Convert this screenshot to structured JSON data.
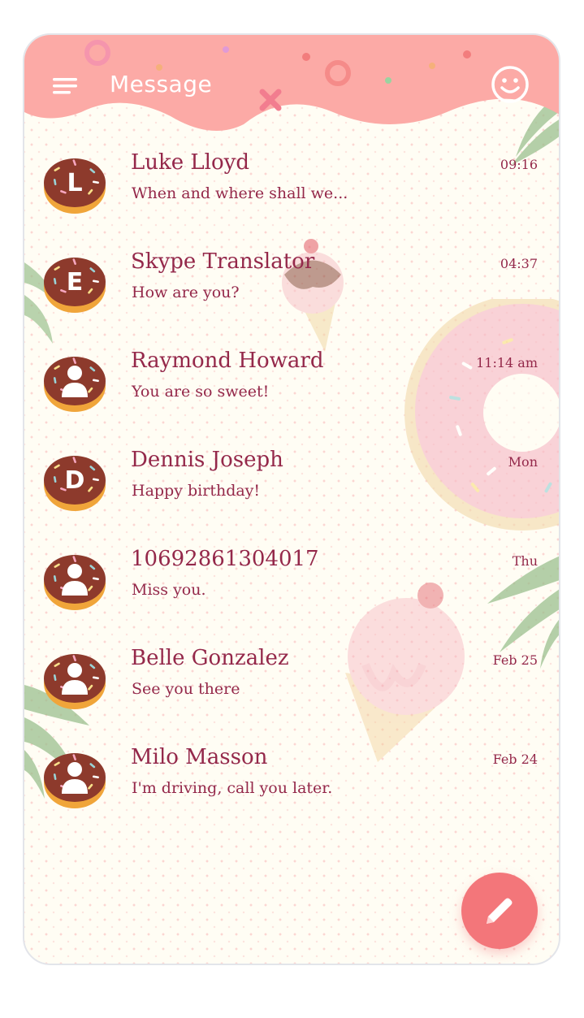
{
  "header": {
    "title": "Message",
    "menu_icon": "menu-icon",
    "smiley_icon": "smiley-icon",
    "color": "#fcaaa6"
  },
  "conversations": [
    {
      "name": "Luke Lloyd",
      "preview": "When and where shall we...",
      "time": "09:16",
      "avatar_letter": "L",
      "avatar_type": "letter"
    },
    {
      "name": "Skype Translator",
      "preview": "How are you?",
      "time": "04:37",
      "avatar_letter": "E",
      "avatar_type": "letter"
    },
    {
      "name": "Raymond Howard",
      "preview": "You are so sweet!",
      "time": "11:14 am",
      "avatar_letter": "",
      "avatar_type": "person"
    },
    {
      "name": "Dennis Joseph",
      "preview": "Happy birthday!",
      "time": "Mon",
      "avatar_letter": "D",
      "avatar_type": "letter"
    },
    {
      "name": "10692861304017",
      "preview": "Miss you.",
      "time": "Thu",
      "avatar_letter": "",
      "avatar_type": "person"
    },
    {
      "name": "Belle Gonzalez",
      "preview": "See you there",
      "time": "Feb 25",
      "avatar_letter": "",
      "avatar_type": "person"
    },
    {
      "name": "Milo Masson",
      "preview": "I'm driving, call you later.",
      "time": "Feb 24",
      "avatar_letter": "",
      "avatar_type": "person"
    }
  ],
  "compose": {
    "icon": "pencil-icon",
    "color": "#f3767a"
  },
  "theme": {
    "text_color": "#94284a",
    "background": "#fffdf4",
    "accent": "#fcaaa6"
  }
}
